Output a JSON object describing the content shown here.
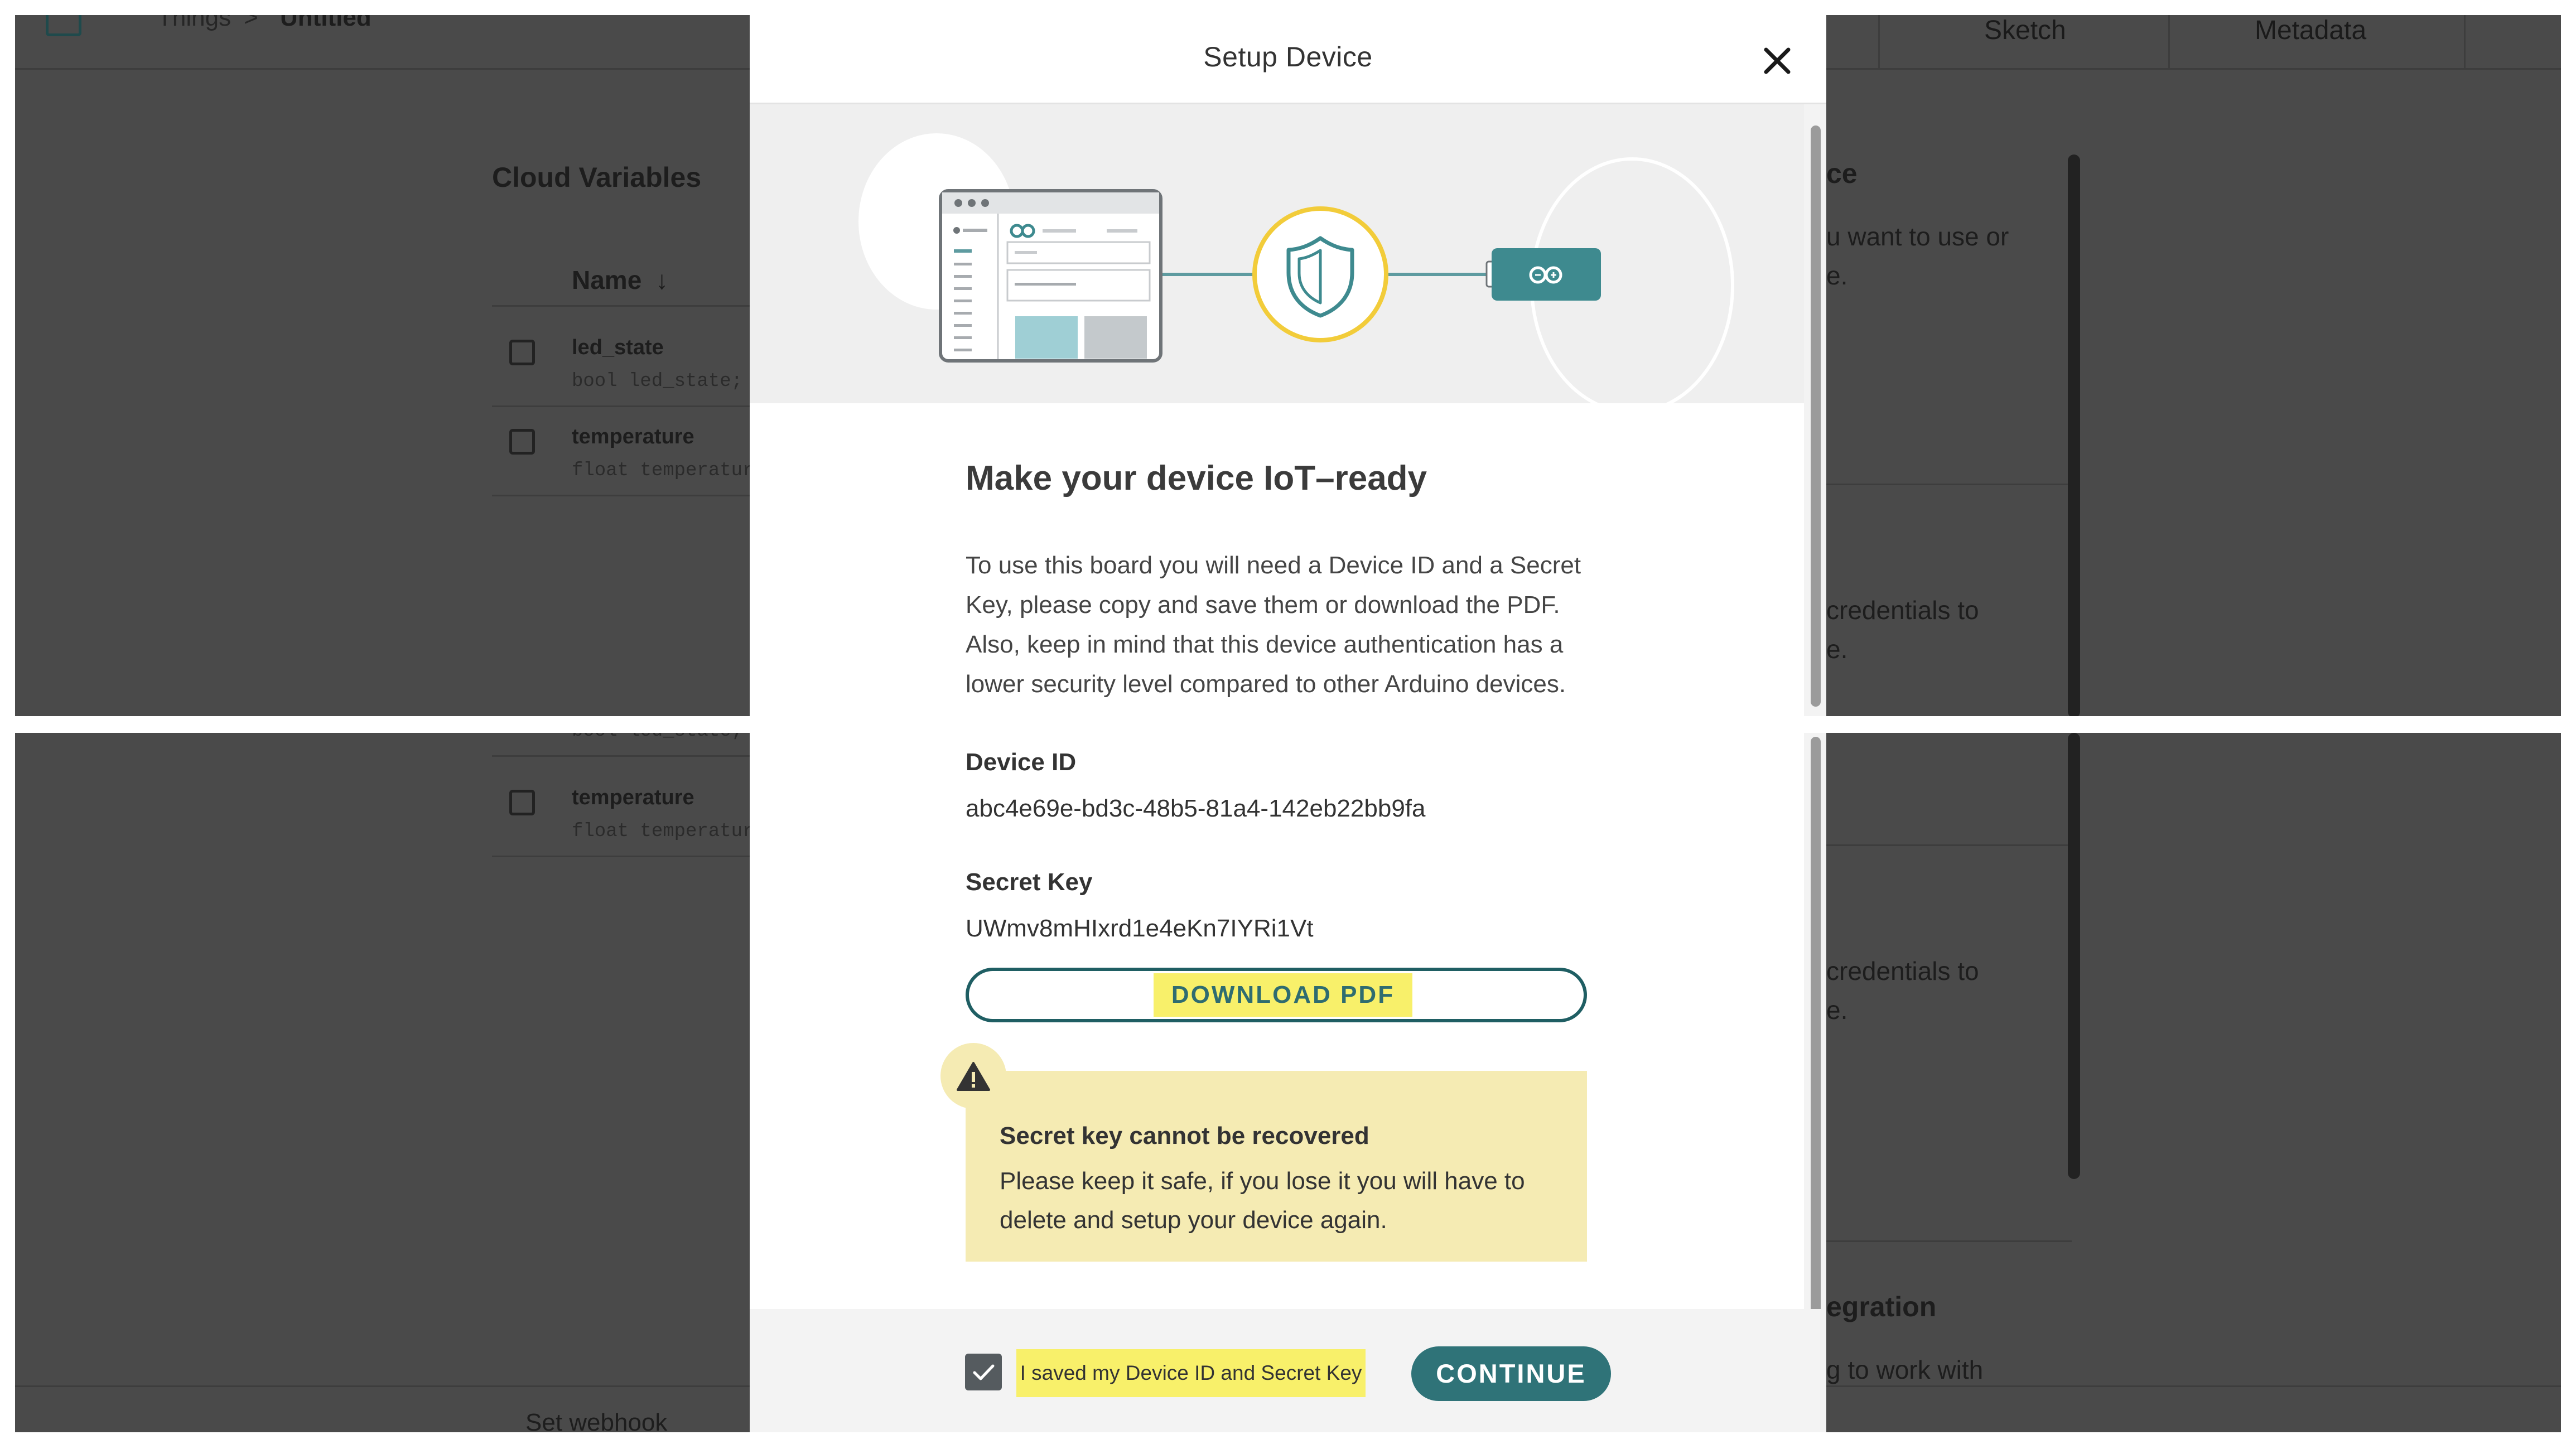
{
  "background": {
    "breadcrumb": {
      "parent": "Things",
      "separator": ">",
      "current": "Untitled"
    },
    "tabs": [
      {
        "label": "Sketch"
      },
      {
        "label": "Metadata"
      }
    ],
    "cloud_variables": {
      "title": "Cloud Variables",
      "column_name": "Name",
      "variables": [
        {
          "name": "led_state",
          "declaration": "bool led_state;"
        },
        {
          "name": "temperature",
          "declaration": "float temperatur"
        }
      ],
      "partial_declaration": "bool led_state;"
    },
    "right_column_fragments": {
      "device_title": "ce",
      "device_line1": "u want to use or",
      "device_line2": "e.",
      "credentials_line1": "credentials to",
      "credentials_line2": "e.",
      "integration_title": "egration",
      "integration_line": "g to work with"
    },
    "footer_link": "Set webhook"
  },
  "modal": {
    "title": "Setup Device",
    "close_icon": "close-icon",
    "hero_icons": [
      "browser-window-illustration",
      "shield-icon",
      "arduino-board-icon"
    ],
    "heading": "Make your device IoT–ready",
    "description_lines": [
      "To use this board you will need a Device ID and a Secret",
      "Key, please copy and save them or download the PDF.",
      "Also, keep in mind that this device authentication has a",
      "lower security level compared to other Arduino devices."
    ],
    "device_id_label": "Device ID",
    "device_id_value": "abc4e69e-bd3c-48b5-81a4-142eb22bb9fa",
    "secret_key_label": "Secret Key",
    "secret_key_value": "UWmv8mHIxrd1e4eKn7IYRi1Vt",
    "download_label": "DOWNLOAD PDF",
    "warning": {
      "icon": "warning-icon",
      "title": "Secret key cannot be recovered",
      "lines": [
        "Please keep it safe, if you lose it you will have to",
        "delete and setup your device again."
      ]
    },
    "saved_checkbox": {
      "checked": true,
      "label": "I saved my Device ID and Secret Key"
    },
    "continue_label": "CONTINUE"
  },
  "colors": {
    "accent": "#2f7378",
    "highlight": "#f8f06a",
    "warning_bg": "#f5ebb3",
    "overlay": "#4a4a4a",
    "shield_ring": "#f2cc3a"
  }
}
